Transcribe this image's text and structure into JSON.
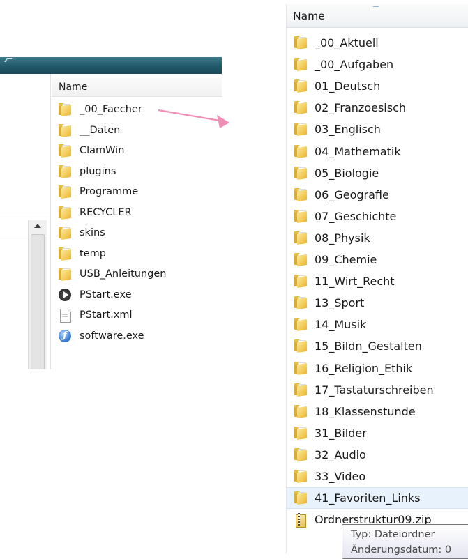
{
  "left_explorer": {
    "column_header": "Name",
    "items": [
      {
        "name": "_00_Faecher",
        "icon": "folder-icon"
      },
      {
        "name": "__Daten",
        "icon": "folder-icon"
      },
      {
        "name": "ClamWin",
        "icon": "folder-icon"
      },
      {
        "name": "plugins",
        "icon": "folder-icon"
      },
      {
        "name": "Programme",
        "icon": "folder-icon"
      },
      {
        "name": "RECYCLER",
        "icon": "folder-icon"
      },
      {
        "name": "skins",
        "icon": "folder-icon"
      },
      {
        "name": "temp",
        "icon": "folder-icon"
      },
      {
        "name": "USB_Anleitungen",
        "icon": "folder-icon"
      },
      {
        "name": "PStart.exe",
        "icon": "pstart-exe-icon"
      },
      {
        "name": "PStart.xml",
        "icon": "xml-file-icon"
      },
      {
        "name": "software.exe",
        "icon": "software-exe-icon"
      }
    ]
  },
  "arrow": {
    "color": "#ef8fb5"
  },
  "right_explorer": {
    "column_header": "Name",
    "items": [
      {
        "name": "_00_Aktuell"
      },
      {
        "name": "_00_Aufgaben"
      },
      {
        "name": "01_Deutsch"
      },
      {
        "name": "02_Franzoesisch"
      },
      {
        "name": "03_Englisch"
      },
      {
        "name": "04_Mathematik"
      },
      {
        "name": "05_Biologie"
      },
      {
        "name": "06_Geografie"
      },
      {
        "name": "07_Geschichte"
      },
      {
        "name": "08_Physik"
      },
      {
        "name": "09_Chemie"
      },
      {
        "name": "11_Wirt_Recht"
      },
      {
        "name": "13_Sport"
      },
      {
        "name": "14_Musik"
      },
      {
        "name": "15_Bildn_Gestalten"
      },
      {
        "name": "16_Religion_Ethik"
      },
      {
        "name": "17_Tastaturschreiben"
      },
      {
        "name": "18_Klassenstunde"
      },
      {
        "name": "31_Bilder"
      },
      {
        "name": "32_Audio"
      },
      {
        "name": "33_Video"
      },
      {
        "name": "41_Favoriten_Links"
      }
    ],
    "zip_item": "Ordnerstruktur09.zip",
    "hover_color": "#e8f2fc"
  },
  "tooltip": {
    "line1": "Typ: Dateiordner",
    "line2": "Änderungsdatum: 0"
  }
}
